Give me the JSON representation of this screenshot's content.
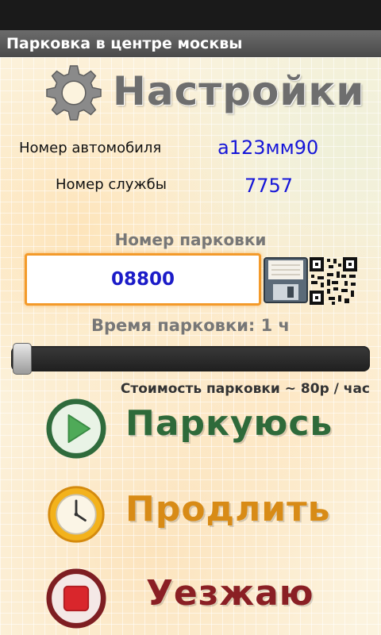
{
  "app": {
    "title": "Парковка в центре москвы"
  },
  "settings": {
    "title": "Настройки",
    "icon": "gear-icon"
  },
  "car": {
    "label": "Номер автомобиля",
    "value": "а123мм90"
  },
  "service": {
    "label": "Номер службы",
    "value": "7757"
  },
  "parking": {
    "label": "Номер парковки",
    "value": "08800"
  },
  "time": {
    "label": "Время парковки: 1 ч",
    "slider_fraction": 0.0
  },
  "cost": {
    "label": "Стоимость парковки ~ 80р / час"
  },
  "actions": [
    {
      "label": "Паркуюсь",
      "icon": "play-icon",
      "color": "#2e6a3a"
    },
    {
      "label": "Продлить",
      "icon": "clock-icon",
      "color": "#d88b16"
    },
    {
      "label": "Уезжаю",
      "icon": "stop-icon",
      "color": "#8a1f24"
    }
  ],
  "colors": {
    "accent": "#f39a2a",
    "value_text": "#1616d8"
  }
}
